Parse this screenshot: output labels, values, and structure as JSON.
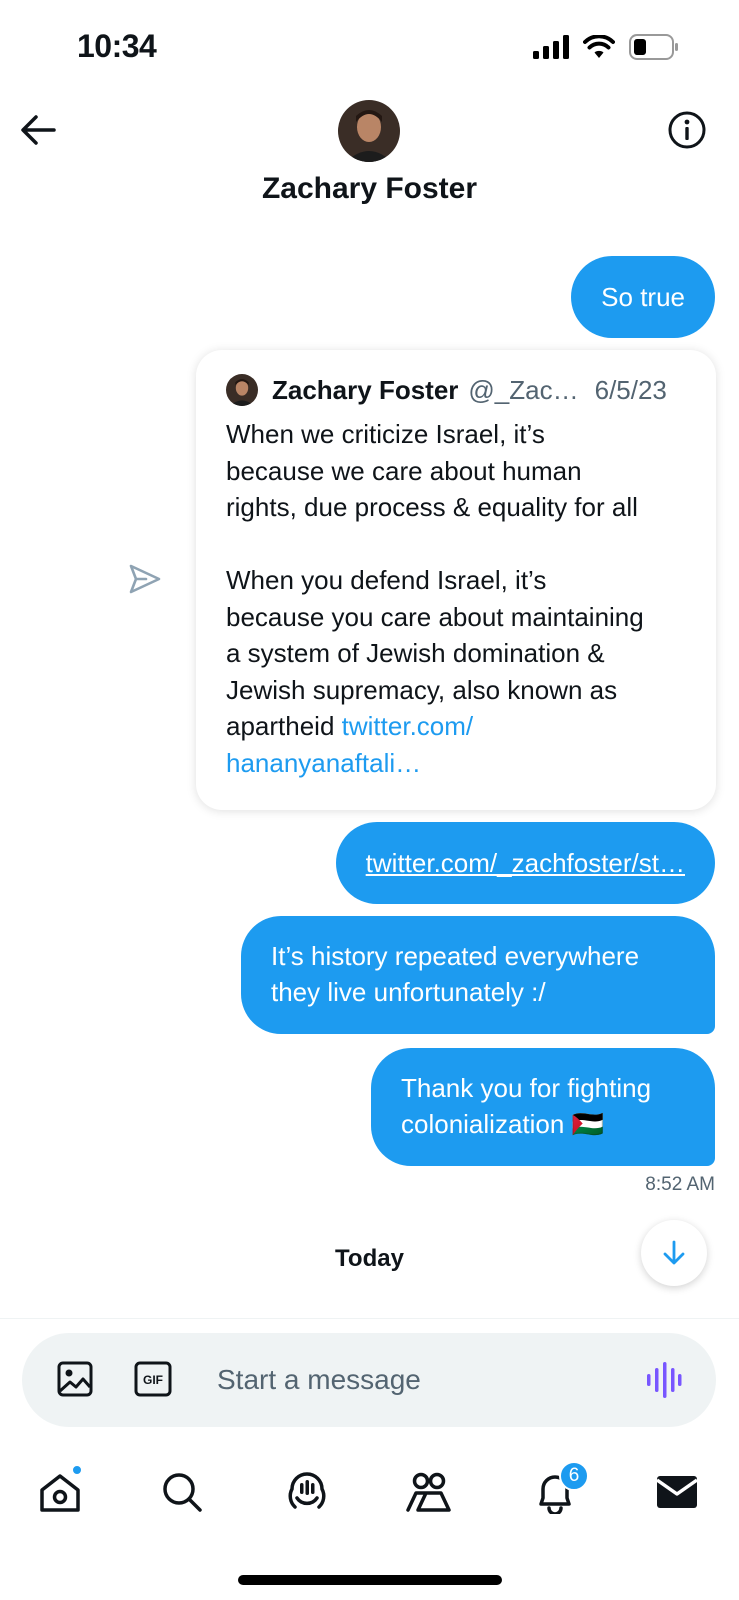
{
  "status_bar": {
    "time": "10:34"
  },
  "header": {
    "contact_name": "Zachary Foster"
  },
  "messages": {
    "outgoing_1": "So true",
    "link_message": "twitter.com/_zachfoster/st…",
    "outgoing_2": "It’s history repeated everywhere they live unfortunately :/",
    "outgoing_3": "Thank you for fighting colonialization 🇵🇸",
    "timestamp": "8:52 AM"
  },
  "quoted_tweet": {
    "author_name": "Zachary Foster",
    "handle": "@_Zac…",
    "date": "6/5/23",
    "body": "When we criticize Israel, it’s\nbecause we care about human\nrights, due process & equality for all\n\nWhen you defend Israel, it’s\nbecause you care about maintaining\na system of Jewish domination &\nJewish supremacy, also known as\napartheid ",
    "link": "twitter.com/\nhananyanaftali…"
  },
  "day_separator": "Today",
  "composer": {
    "placeholder": "Start a message"
  },
  "tabbar": {
    "notifications_count": "6"
  },
  "colors": {
    "accent": "#1d9bf0",
    "voice_purple": "#7856ff"
  }
}
